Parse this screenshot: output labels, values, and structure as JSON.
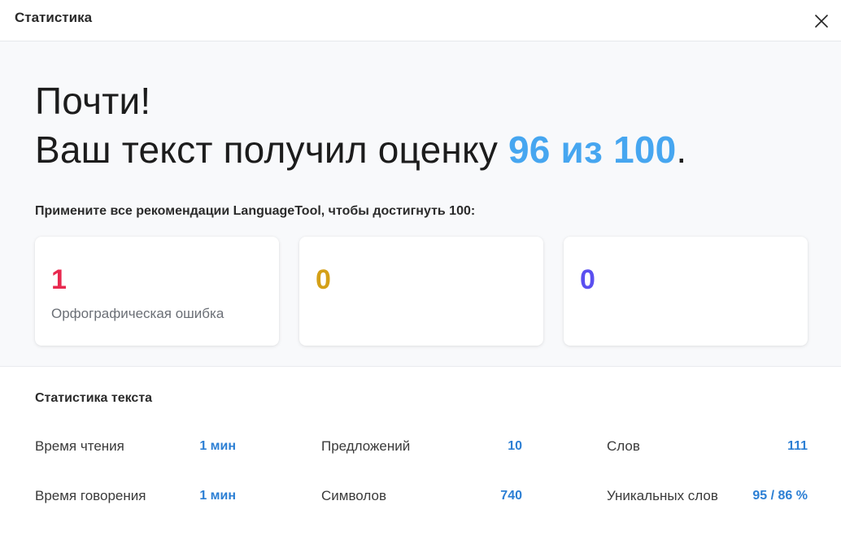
{
  "header": {
    "title": "Статистика",
    "close_icon": "close-icon"
  },
  "score": {
    "line1": "Почти!",
    "line2_prefix": "Ваш текст получил оценку ",
    "score_text": "96 из 100",
    "line2_suffix": ".",
    "score_color": "#46a6f0"
  },
  "recommendation": "Примените все рекомендации LanguageTool, чтобы достигнуть 100:",
  "cards": [
    {
      "count": "1",
      "label": "Орфографическая ошибка",
      "color": "#e8294f"
    },
    {
      "count": "0",
      "label": "",
      "color": "#d4a017"
    },
    {
      "count": "0",
      "label": "",
      "color": "#5a4ff0"
    }
  ],
  "text_stats": {
    "title": "Статистика текста",
    "items": [
      {
        "label": "Время чтения",
        "value": "1 мин"
      },
      {
        "label": "Предложений",
        "value": "10"
      },
      {
        "label": "Слов",
        "value": "111"
      },
      {
        "label": "Время говорения",
        "value": "1 мин"
      },
      {
        "label": "Символов",
        "value": "740"
      },
      {
        "label": "Уникальных слов",
        "value": "95 / 86 %"
      }
    ],
    "value_color": "#2c7fd4"
  }
}
